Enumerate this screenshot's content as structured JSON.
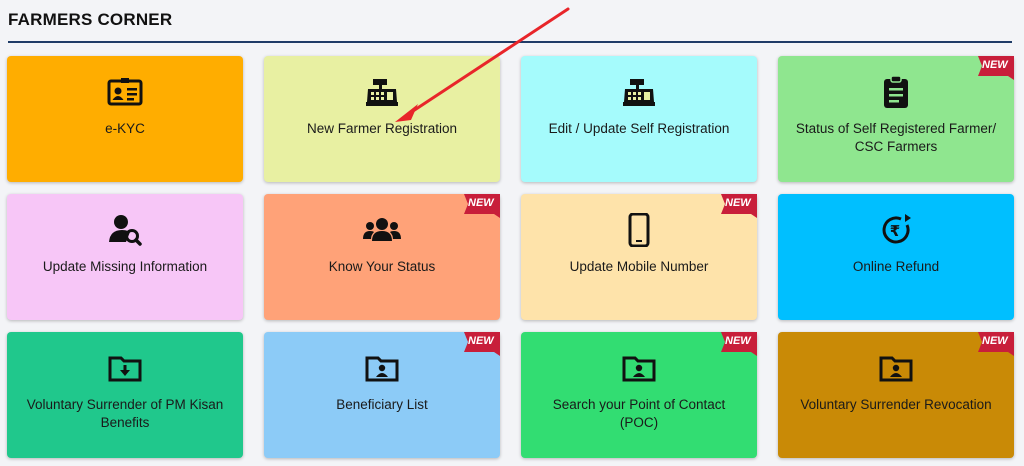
{
  "section": {
    "title": "FARMERS CORNER"
  },
  "badge_text": "NEW",
  "colors": {
    "title_rule": "#1f3b67",
    "badge": "#c81e3a",
    "arrow": "#e8252a"
  },
  "cards": [
    {
      "label": "e-KYC",
      "icon": "id-card-icon",
      "color": "#ffad00",
      "is_new": false
    },
    {
      "label": "New Farmer Registration",
      "icon": "cash-register-icon",
      "color": "#e8f0a2",
      "is_new": false
    },
    {
      "label": "Edit / Update Self Registration",
      "icon": "cash-register-icon",
      "color": "#a5fbfc",
      "is_new": false
    },
    {
      "label": "Status of Self Registered Farmer/ CSC Farmers",
      "icon": "clipboard-icon",
      "color": "#8fe68f",
      "is_new": true
    },
    {
      "label": "Update Missing Information",
      "icon": "user-search-icon",
      "color": "#f7c6f7",
      "is_new": false
    },
    {
      "label": "Know Your Status",
      "icon": "users-icon",
      "color": "#ffa278",
      "is_new": true
    },
    {
      "label": "Update Mobile Number",
      "icon": "mobile-icon",
      "color": "#fee3aa",
      "is_new": true
    },
    {
      "label": "Online Refund",
      "icon": "rupee-refund-icon",
      "color": "#00bfff",
      "is_new": false
    },
    {
      "label": "Voluntary Surrender of PM Kisan Benefits",
      "icon": "folder-download-icon",
      "color": "#20c88c",
      "is_new": false
    },
    {
      "label": "Beneficiary List",
      "icon": "folder-user-icon",
      "color": "#8ccbf7",
      "is_new": true
    },
    {
      "label": "Search your Point of Contact (POC)",
      "icon": "folder-user-icon",
      "color": "#32dd72",
      "is_new": true
    },
    {
      "label": "Voluntary Surrender Revocation",
      "icon": "folder-user-icon",
      "color": "#c98a06",
      "is_new": true
    }
  ]
}
